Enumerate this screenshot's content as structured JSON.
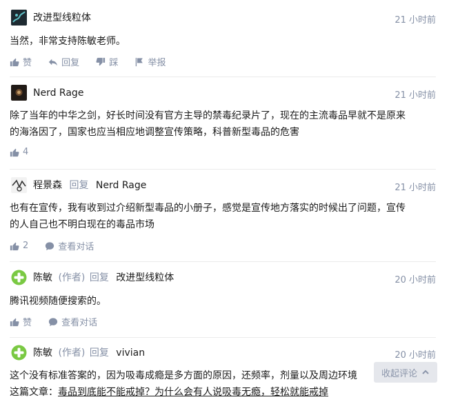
{
  "comments": [
    {
      "author": "改进型线粒体",
      "time": "21 小时前",
      "content": "当然，非常支持陈敏老师。",
      "actions": {
        "like": "赞",
        "reply": "回复",
        "dislike": "踩",
        "report": "举报"
      }
    },
    {
      "author": "Nerd Rage",
      "time": "21 小时前",
      "content_line1": "除了当年的中华之剑，好长时间没有官方主导的禁毒纪录片了，现在的主流毒品早就不是原来",
      "content_line2": "的海洛因了，国家也应当相应地调整宣传策略，科普新型毒品的危害",
      "likes": "4"
    },
    {
      "author": "程景森",
      "reply_word": "回复",
      "reply_to": "Nerd Rage",
      "time": "21 小时前",
      "content_line1": "也有在宣传，我有收到过介绍新型毒品的小册子，感觉是宣传地方落实的时候出了问题，宣传",
      "content_line2": "的人自己也不明白现在的毒品市场",
      "likes": "2",
      "view_conversation": "查看对话"
    },
    {
      "author": "陈敏",
      "author_tag": "(作者)",
      "reply_word": "回复",
      "reply_to": "改进型线粒体",
      "time": "20 小时前",
      "content": "腾讯视频随便搜索的。",
      "like": "赞",
      "view_conversation": "查看对话"
    },
    {
      "author": "陈敏",
      "author_tag": "(作者)",
      "reply_word": "回复",
      "reply_to": "vivian",
      "time": "20 小时前",
      "content_line1": "这个没有标准答案的，因为吸毒成瘾是多方面的原因，还频率，剂量以及周边环境",
      "content_line2_prefix": "这篇文章：",
      "article_link": "毒品到底能不能戒掉？为什么会有人说吸毒无瘾，轻松就能戒掉"
    }
  ],
  "collapse_button": "收起评论",
  "colors": {
    "muted": "#8590a6",
    "text": "#1a1a1a",
    "divider": "#ebebeb",
    "green_avatar": "#7ac943"
  }
}
